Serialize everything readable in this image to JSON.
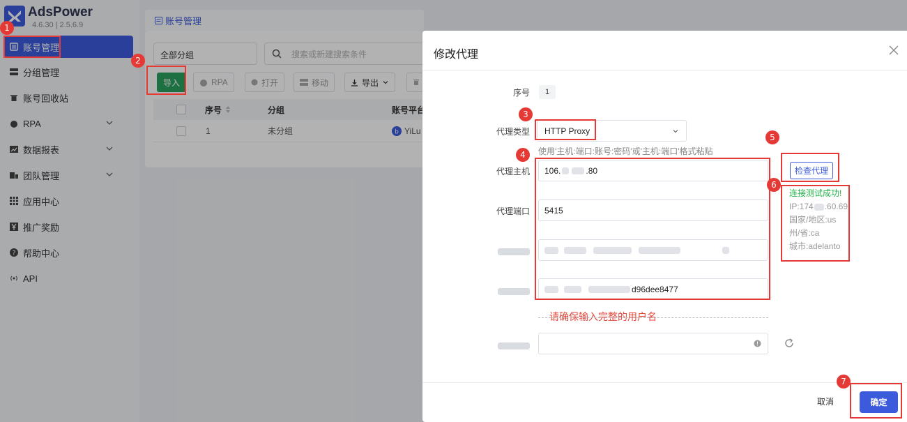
{
  "app": {
    "name": "AdsPower",
    "version": "4.6.30 | 2.5.6.9"
  },
  "sidebar": {
    "items": [
      {
        "label": "账号管理",
        "icon": "list-icon"
      },
      {
        "label": "分组管理",
        "icon": "server-icon"
      },
      {
        "label": "账号回收站",
        "icon": "trash-icon"
      },
      {
        "label": "RPA",
        "icon": "robot-icon"
      },
      {
        "label": "数据报表",
        "icon": "chart-icon"
      },
      {
        "label": "团队管理",
        "icon": "team-icon"
      },
      {
        "label": "应用中心",
        "icon": "grid-icon"
      },
      {
        "label": "推广奖励",
        "icon": "yen-icon"
      },
      {
        "label": "帮助中心",
        "icon": "help-icon"
      },
      {
        "label": "API",
        "icon": "broadcast-icon"
      }
    ]
  },
  "main": {
    "breadcrumb": "账号管理",
    "group_select": "全部分组",
    "search_placeholder": "搜索或新建搜索条件",
    "toolbar": {
      "import": "导入",
      "rpa": "RPA",
      "open": "打开",
      "move": "移动",
      "export": "导出"
    },
    "table": {
      "headers": [
        "序号",
        "分组",
        "账号平台"
      ],
      "rows": [
        {
          "index": "1",
          "group": "未分组",
          "platform": "YiLu"
        }
      ]
    }
  },
  "dialog": {
    "title": "修改代理",
    "fields": {
      "seq_label": "序号",
      "seq_value": "1",
      "proxy_type_label": "代理类型",
      "proxy_type_value": "HTTP Proxy",
      "paste_hint": "使用'主机:端口:账号:密码'或'主机:端口'格式粘贴",
      "host_label": "代理主机",
      "host_value_prefix": "106.",
      "host_value_suffix": ".80",
      "port_label": "代理端口",
      "port_value": "5415",
      "password_value_suffix": "d96dee8477"
    },
    "check_button": "检查代理",
    "result": {
      "success": "连接测试成功!",
      "ip": "IP:174",
      "ip_suffix": ".60.69",
      "country": "国家/地区:us",
      "state": "州/省:ca",
      "city": "城市:adelanto"
    },
    "error_message": "请确保输入完整的用户名",
    "cancel": "取消",
    "confirm": "确定"
  },
  "annotations": [
    "1",
    "2",
    "3",
    "4",
    "5",
    "6",
    "7"
  ],
  "colors": {
    "accent": "#3c5bdc",
    "import_green": "#2aa15d",
    "annotation_red": "#e53935",
    "success_green": "#22b34a"
  }
}
